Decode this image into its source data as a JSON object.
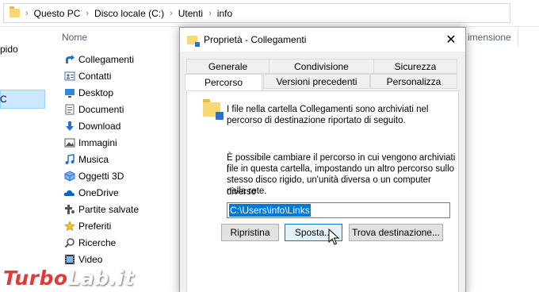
{
  "breadcrumb": [
    "Questo PC",
    "Disco locale (C:)",
    "Utenti",
    "info"
  ],
  "sidebar": {
    "item_top": "pido",
    "item_sel": "C"
  },
  "list": {
    "col_name": "Nome",
    "col_size": "imensione",
    "items": [
      {
        "label": "Collegamenti",
        "icon": "shortcut-arrow-icon"
      },
      {
        "label": "Contatti",
        "icon": "contacts-icon"
      },
      {
        "label": "Desktop",
        "icon": "desktop-icon"
      },
      {
        "label": "Documenti",
        "icon": "documents-icon"
      },
      {
        "label": "Download",
        "icon": "download-icon"
      },
      {
        "label": "Immagini",
        "icon": "pictures-icon"
      },
      {
        "label": "Musica",
        "icon": "music-icon"
      },
      {
        "label": "Oggetti 3D",
        "icon": "3d-objects-icon"
      },
      {
        "label": "OneDrive",
        "icon": "onedrive-icon"
      },
      {
        "label": "Partite salvate",
        "icon": "saved-games-icon"
      },
      {
        "label": "Preferiti",
        "icon": "favorites-icon"
      },
      {
        "label": "Ricerche",
        "icon": "searches-icon"
      },
      {
        "label": "Video",
        "icon": "videos-icon"
      }
    ]
  },
  "dialog": {
    "title": "Proprietà - Collegamenti",
    "tabs_row1": [
      "Generale",
      "Condivisione",
      "Sicurezza"
    ],
    "tabs_row2": [
      "Percorso",
      "Versioni precedenti",
      "Personalizza"
    ],
    "info_line1": "I file nella cartella Collegamenti sono archiviati nel",
    "info_line2": "percorso di destinazione riportato di seguito.",
    "desc_line1": "È possibile cambiare il percorso in cui vengono archiviati i",
    "desc_line2": "file in questa cartella, impostando un altro percorso sullo",
    "desc_line3": "stesso disco rigido, un'unità diversa o un computer diverso",
    "desc_line4": "nella rete.",
    "path_value": "C:\\Users\\info\\Links",
    "btn_restore": "Ripristina",
    "btn_move": "Sposta...",
    "btn_find": "Trova destinazione..."
  },
  "watermark": {
    "part1": "Turbo",
    "part2": "Lab.it"
  },
  "colors": {
    "accent": "#0078d7",
    "selection": "#cce8ff",
    "folder": "#f8d775"
  }
}
